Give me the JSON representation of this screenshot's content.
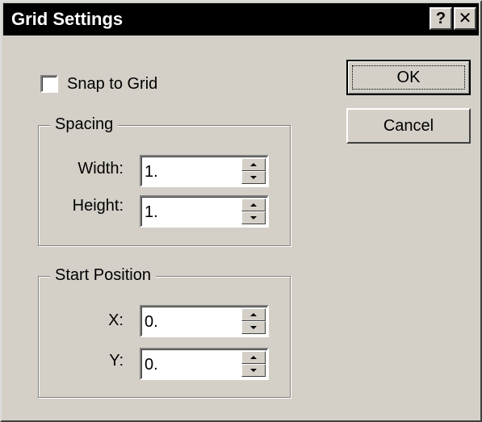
{
  "window": {
    "title": "Grid Settings",
    "help_label": "?",
    "close_label": "✕"
  },
  "snap": {
    "label": "Snap to Grid",
    "checked": false
  },
  "spacing": {
    "legend": "Spacing",
    "width_label": "Width:",
    "width_value": "1.",
    "height_label": "Height:",
    "height_value": "1."
  },
  "start": {
    "legend": "Start Position",
    "x_label": "X:",
    "x_value": "0.",
    "y_label": "Y:",
    "y_value": "0."
  },
  "buttons": {
    "ok": "OK",
    "cancel": "Cancel"
  },
  "icons": {
    "help": "help-icon",
    "close": "close-icon",
    "spin_up": "arrow-up-icon",
    "spin_down": "arrow-down-icon"
  },
  "colors": {
    "titlebar": "#000000",
    "face": "#d4d0c8"
  }
}
